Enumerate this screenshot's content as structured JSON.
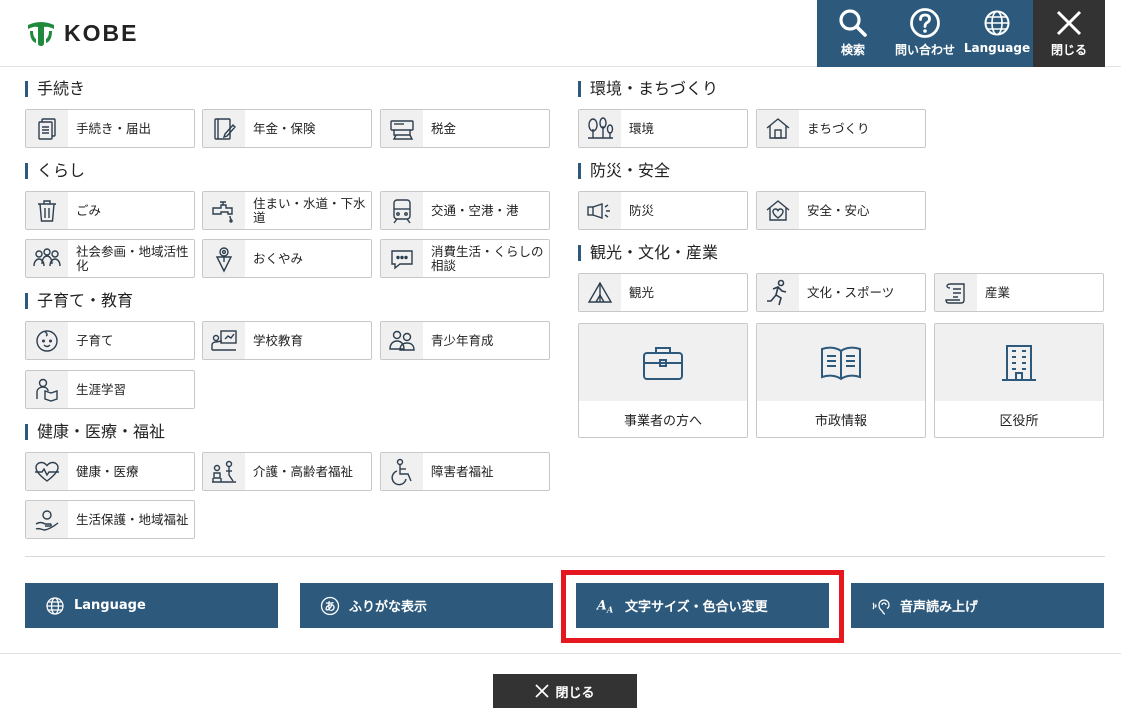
{
  "header": {
    "logo_text": "KOBE",
    "buttons": [
      {
        "label": "検索",
        "icon": "search-icon"
      },
      {
        "label": "問い合わせ",
        "icon": "question-icon"
      },
      {
        "label": "Language",
        "icon": "globe-icon"
      },
      {
        "label": "閉じる",
        "icon": "close-icon"
      }
    ]
  },
  "sections": {
    "tetsuzuki": {
      "title": "手続き",
      "items": [
        "手続き・届出",
        "年金・保険",
        "税金"
      ]
    },
    "kurashi": {
      "title": "くらし",
      "items": [
        "ごみ",
        "住まい・水道・下水道",
        "交通・空港・港",
        "社会参画・地域活性化",
        "おくやみ",
        "消費生活・くらしの相談"
      ]
    },
    "kosodate": {
      "title": "子育て・教育",
      "items": [
        "子育て",
        "学校教育",
        "青少年育成",
        "生涯学習"
      ]
    },
    "kenko": {
      "title": "健康・医療・福祉",
      "items": [
        "健康・医療",
        "介護・高齢者福祉",
        "障害者福祉",
        "生活保護・地域福祉"
      ]
    },
    "kankyo": {
      "title": "環境・まちづくり",
      "items": [
        "環境",
        "まちづくり"
      ]
    },
    "bousai": {
      "title": "防災・安全",
      "items": [
        "防災",
        "安全・安心"
      ]
    },
    "kanko": {
      "title": "観光・文化・産業",
      "items": [
        "観光",
        "文化・スポーツ",
        "産業"
      ]
    }
  },
  "big_tiles": [
    "事業者の方へ",
    "市政情報",
    "区役所"
  ],
  "actions": [
    {
      "label": "Language",
      "icon": "globe-icon"
    },
    {
      "label": "ふりがな表示",
      "icon": "furigana-icon"
    },
    {
      "label": "文字サイズ・色合い変更",
      "icon": "font-size-icon"
    },
    {
      "label": "音声読み上げ",
      "icon": "ear-icon"
    }
  ],
  "close_label": "閉じる",
  "colors": {
    "accent": "#2d5a7c",
    "dark": "#333333",
    "highlight": "#e5171f",
    "logo_green": "#1f8a3c"
  }
}
